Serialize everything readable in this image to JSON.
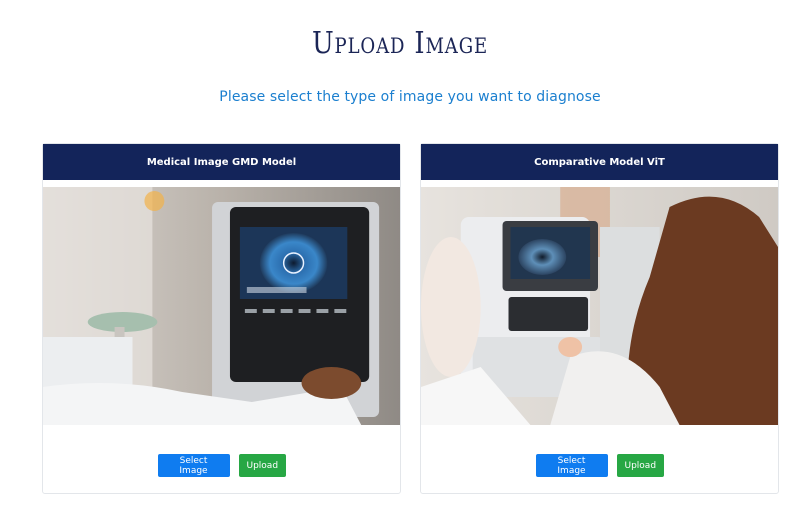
{
  "header": {
    "title": "Upload Image",
    "subtitle": "Please select the type of image you want to diagnose"
  },
  "cards": [
    {
      "title": "Medical Image GMD Model",
      "select_label": "Select Image",
      "upload_label": "Upload"
    },
    {
      "title": "Comparative Model ViT",
      "select_label": "Select Image",
      "upload_label": "Upload"
    }
  ],
  "colors": {
    "title": "#1b2556",
    "subtitle": "#1b7fcf",
    "card_header_bg": "#13245a",
    "select_button": "#0f7cf0",
    "upload_button": "#27a744"
  }
}
